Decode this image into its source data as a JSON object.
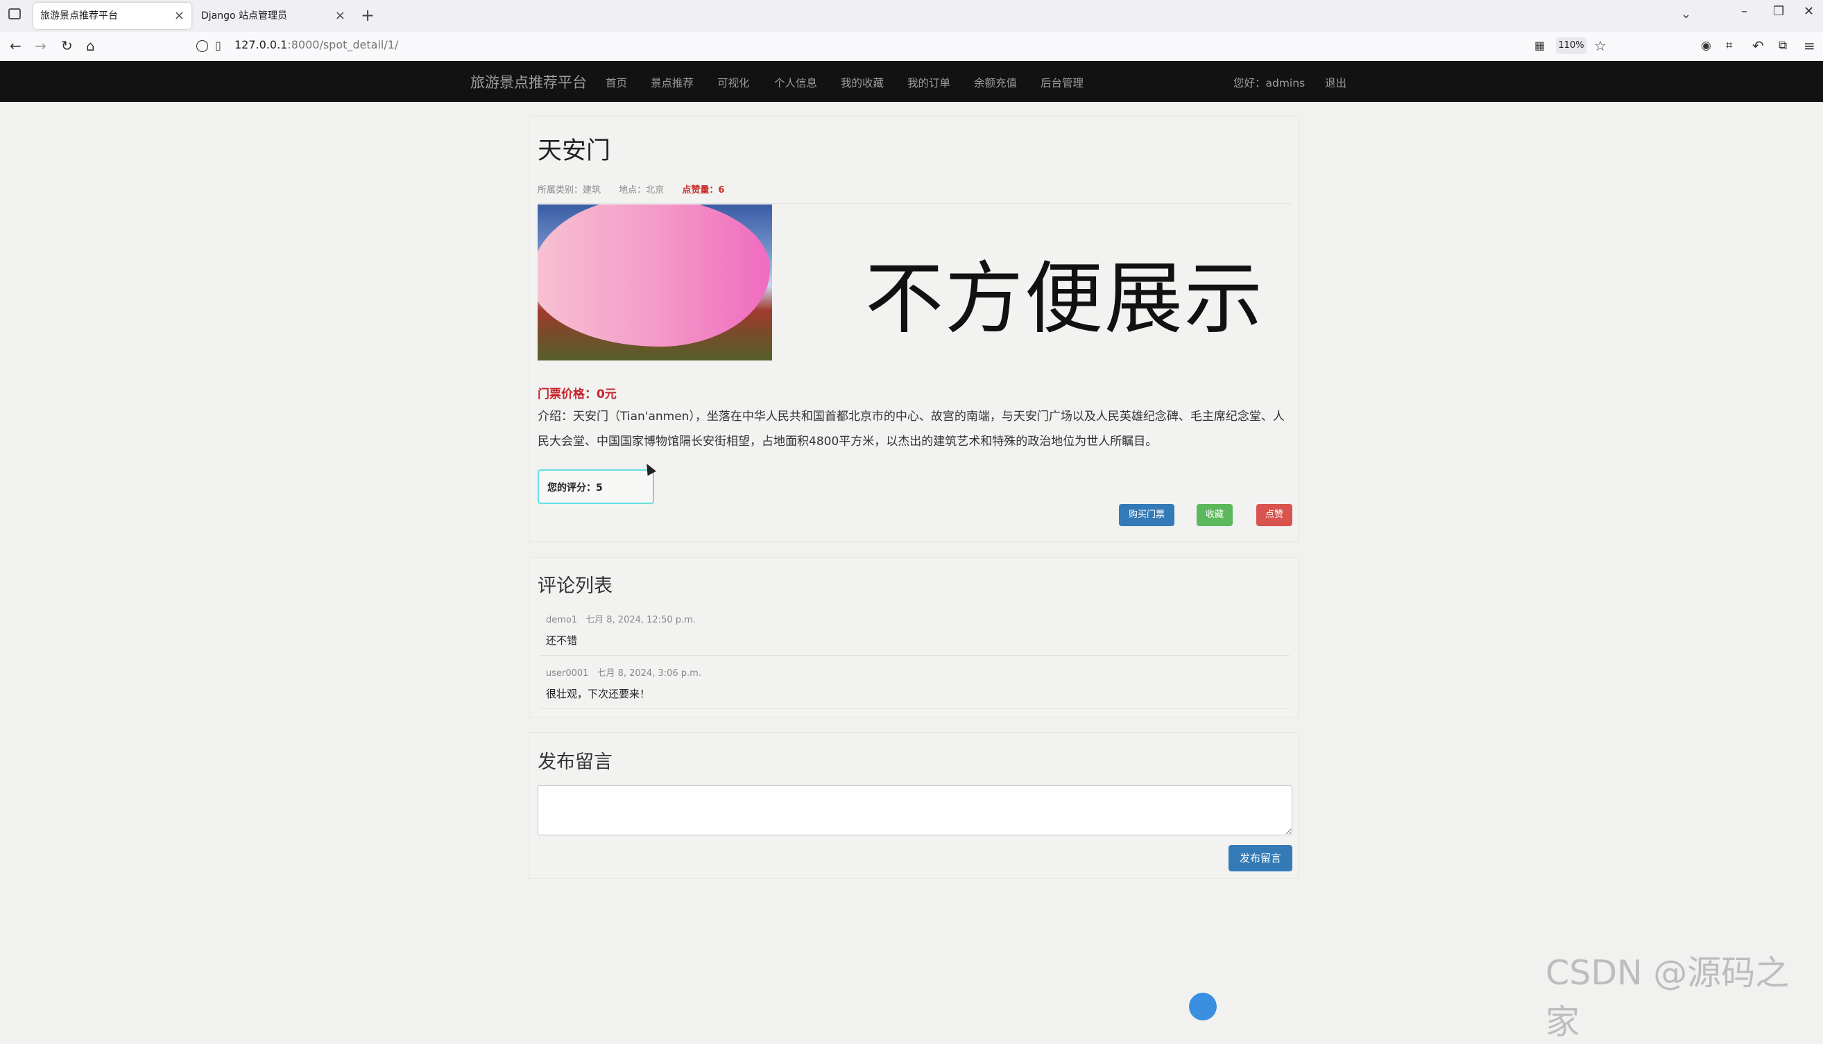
{
  "browser": {
    "tabs": [
      {
        "title": "旅游景点推荐平台",
        "active": true
      },
      {
        "title": "Django 站点管理员",
        "active": false
      }
    ],
    "url_host": "127.0.0.1",
    "url_path": ":8000/spot_detail/1/",
    "zoom": "110%"
  },
  "site_nav": {
    "brand": "旅游景点推荐平台",
    "links": [
      "首页",
      "景点推荐",
      "可视化",
      "个人信息",
      "我的收藏",
      "我的订单",
      "余额充值",
      "后台管理"
    ],
    "greeting": "您好：admins",
    "logout": "退出"
  },
  "spot": {
    "title": "天安门",
    "category": "所属类别：建筑",
    "location": "地点：北京",
    "likes": "点赞量：6",
    "image_caption": "不方便展示",
    "price": "门票价格：0元",
    "intro": "介绍：天安门（Tian'anmen），坐落在中华人民共和国首都北京市的中心、故宫的南端，与天安门广场以及人民英雄纪念碑、毛主席纪念堂、人民大会堂、中国国家博物馆隔长安街相望，占地面积4800平方米，以杰出的建筑艺术和特殊的政治地位为世人所瞩目。",
    "rating": "您的评分：5",
    "buttons": {
      "buy": "购买门票",
      "favorite": "收藏",
      "like": "点赞"
    }
  },
  "comments": {
    "title": "评论列表",
    "items": [
      {
        "user": "demo1",
        "time": "七月 8, 2024, 12:50 p.m.",
        "text": "还不错"
      },
      {
        "user": "user0001",
        "time": "七月 8, 2024, 3:06 p.m.",
        "text": "很壮观，下次还要来！"
      }
    ]
  },
  "post": {
    "title": "发布留言",
    "textarea_value": "",
    "button": "发布留言"
  },
  "watermark": "CSDN @源码之家"
}
